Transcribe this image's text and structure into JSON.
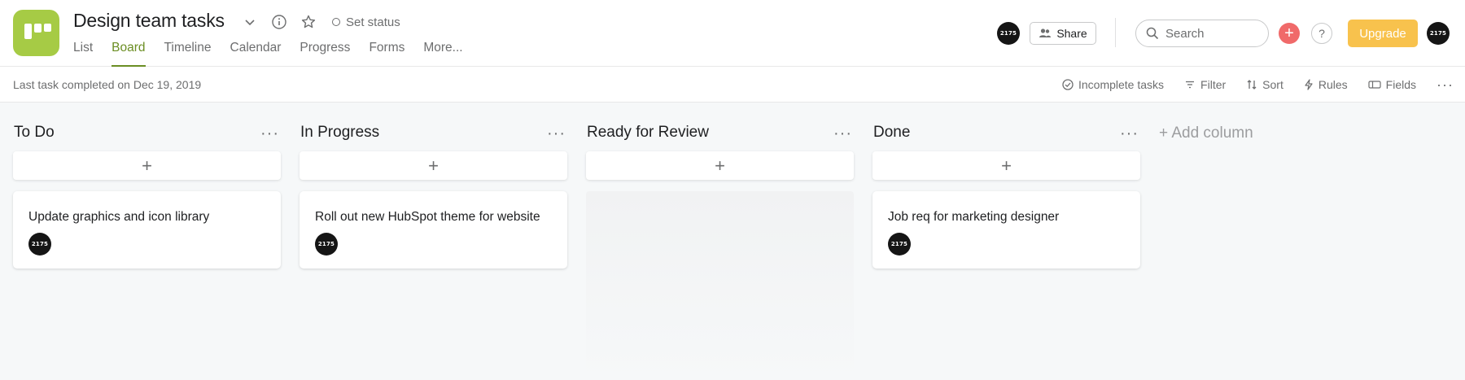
{
  "project": {
    "title": "Design team tasks",
    "set_status": "Set status"
  },
  "tabs": [
    {
      "label": "List",
      "active": false
    },
    {
      "label": "Board",
      "active": true
    },
    {
      "label": "Timeline",
      "active": false
    },
    {
      "label": "Calendar",
      "active": false
    },
    {
      "label": "Progress",
      "active": false
    },
    {
      "label": "Forms",
      "active": false
    },
    {
      "label": "More...",
      "active": false
    }
  ],
  "header_right": {
    "avatar_text": "2175",
    "share_label": "Share",
    "search_placeholder": "Search",
    "plus_symbol": "+",
    "help_symbol": "?",
    "upgrade_label": "Upgrade"
  },
  "subbar": {
    "last_task": "Last task completed on Dec 19, 2019",
    "tools": {
      "incomplete": "Incomplete tasks",
      "filter": "Filter",
      "sort": "Sort",
      "rules": "Rules",
      "fields": "Fields"
    }
  },
  "columns": [
    {
      "title": "To Do",
      "tasks": [
        {
          "name": "Update graphics and icon library",
          "assignee": "2175"
        }
      ]
    },
    {
      "title": "In Progress",
      "tasks": [
        {
          "name": "Roll out new HubSpot theme for website",
          "assignee": "2175"
        }
      ]
    },
    {
      "title": "Ready for Review",
      "tasks": []
    },
    {
      "title": "Done",
      "tasks": [
        {
          "name": "Job req for marketing designer",
          "assignee": "2175"
        }
      ]
    }
  ],
  "add_column_label": "+ Add column",
  "colors": {
    "accent": "#6b8e23",
    "app_icon": "#a6cb45",
    "upgrade": "#f8c24d",
    "plus_button": "#f06a6a"
  }
}
